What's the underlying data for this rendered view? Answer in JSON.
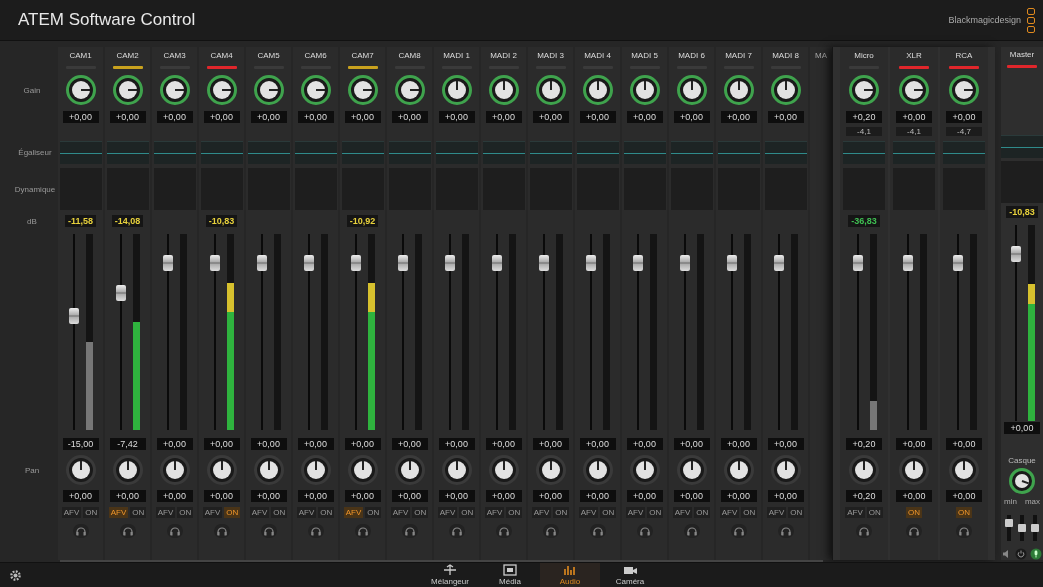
{
  "window": {
    "title": "ATEM Software Control",
    "brand": "Blackmagicdesign"
  },
  "row_labels": {
    "gain": "Gain",
    "eq": "Égaliseur",
    "dynamics": "Dynamique",
    "db": "dB",
    "pan": "Pan"
  },
  "channels": [
    {
      "name": "CAM1",
      "color": "#3a3a3a",
      "gain": {
        "value": "+0,00"
      },
      "peak": {
        "value": "-11,58",
        "kind": "warn"
      },
      "fader": {
        "level": 0.58,
        "value": "-15,00"
      },
      "meter": {
        "level": 0.45,
        "muted": true
      },
      "pan": {
        "value": "+0,00"
      },
      "afv": {
        "label": "AFV",
        "selected": false
      },
      "on": {
        "label": "ON",
        "selected": false
      }
    },
    {
      "name": "CAM2",
      "color": "#c9a21e",
      "gain": {
        "value": "+0,00"
      },
      "peak": {
        "value": "-14,08",
        "kind": "warn"
      },
      "fader": {
        "level": 0.7,
        "value": "-7,42"
      },
      "meter": {
        "level": 0.55,
        "muted": false
      },
      "pan": {
        "value": "+0,00"
      },
      "afv": {
        "label": "AFV",
        "selected": true
      },
      "on": {
        "label": "ON",
        "selected": false
      }
    },
    {
      "name": "CAM3",
      "color": "#3a3a3a",
      "gain": {
        "value": "+0,00"
      },
      "fader": {
        "level": 0.85,
        "value": "+0,00"
      },
      "pan": {
        "value": "+0,00"
      },
      "afv": {
        "label": "AFV",
        "selected": false
      },
      "on": {
        "label": "ON",
        "selected": false
      }
    },
    {
      "name": "CAM4",
      "color": "#e0262b",
      "gain": {
        "value": "+0,00"
      },
      "peak": {
        "value": "-10,83",
        "kind": "warn"
      },
      "fader": {
        "level": 0.85,
        "value": "+0,00"
      },
      "meter": {
        "level": 0.75,
        "muted": false
      },
      "pan": {
        "value": "+0,00"
      },
      "afv": {
        "label": "AFV",
        "selected": false
      },
      "on": {
        "label": "ON",
        "selected": true
      }
    },
    {
      "name": "CAM5",
      "color": "#3a3a3a",
      "gain": {
        "value": "+0,00"
      },
      "fader": {
        "level": 0.85,
        "value": "+0,00"
      },
      "pan": {
        "value": "+0,00"
      },
      "afv": {
        "label": "AFV",
        "selected": false
      },
      "on": {
        "label": "ON",
        "selected": false
      }
    },
    {
      "name": "CAM6",
      "color": "#3a3a3a",
      "gain": {
        "value": "+0,00"
      },
      "fader": {
        "level": 0.85,
        "value": "+0,00"
      },
      "pan": {
        "value": "+0,00"
      },
      "afv": {
        "label": "AFV",
        "selected": false
      },
      "on": {
        "label": "ON",
        "selected": false
      }
    },
    {
      "name": "CAM7",
      "color": "#c9a21e",
      "gain": {
        "value": "+0,00"
      },
      "peak": {
        "value": "-10,92",
        "kind": "warn"
      },
      "fader": {
        "level": 0.85,
        "value": "+0,00"
      },
      "meter": {
        "level": 0.75,
        "muted": false
      },
      "pan": {
        "value": "+0,00"
      },
      "afv": {
        "label": "AFV",
        "selected": true
      },
      "on": {
        "label": "ON",
        "selected": false
      }
    },
    {
      "name": "CAM8",
      "color": "#3a3a3a",
      "gain": {
        "value": "+0,00"
      },
      "fader": {
        "level": 0.85,
        "value": "+0,00"
      },
      "pan": {
        "value": "+0,00"
      },
      "afv": {
        "label": "AFV",
        "selected": false
      },
      "on": {
        "label": "ON",
        "selected": false
      }
    },
    {
      "name": "MADI 1",
      "color": "#3a3a3a",
      "gain": {
        "value": "+0,00"
      },
      "fader": {
        "level": 0.85,
        "value": "+0,00"
      },
      "pan": {
        "value": "+0,00"
      },
      "afv": {
        "label": "AFV",
        "selected": false
      },
      "on": {
        "label": "ON",
        "selected": false
      }
    },
    {
      "name": "MADI 2",
      "color": "#3a3a3a",
      "gain": {
        "value": "+0,00"
      },
      "fader": {
        "level": 0.85,
        "value": "+0,00"
      },
      "pan": {
        "value": "+0,00"
      },
      "afv": {
        "label": "AFV",
        "selected": false
      },
      "on": {
        "label": "ON",
        "selected": false
      }
    },
    {
      "name": "MADI 3",
      "color": "#3a3a3a",
      "gain": {
        "value": "+0,00"
      },
      "fader": {
        "level": 0.85,
        "value": "+0,00"
      },
      "pan": {
        "value": "+0,00"
      },
      "afv": {
        "label": "AFV",
        "selected": false
      },
      "on": {
        "label": "ON",
        "selected": false
      }
    },
    {
      "name": "MADI 4",
      "color": "#3a3a3a",
      "gain": {
        "value": "+0,00"
      },
      "fader": {
        "level": 0.85,
        "value": "+0,00"
      },
      "pan": {
        "value": "+0,00"
      },
      "afv": {
        "label": "AFV",
        "selected": false
      },
      "on": {
        "label": "ON",
        "selected": false
      }
    },
    {
      "name": "MADI 5",
      "color": "#3a3a3a",
      "gain": {
        "value": "+0,00"
      },
      "fader": {
        "level": 0.85,
        "value": "+0,00"
      },
      "pan": {
        "value": "+0,00"
      },
      "afv": {
        "label": "AFV",
        "selected": false
      },
      "on": {
        "label": "ON",
        "selected": false
      }
    },
    {
      "name": "MADI 6",
      "color": "#3a3a3a",
      "gain": {
        "value": "+0,00"
      },
      "fader": {
        "level": 0.85,
        "value": "+0,00"
      },
      "pan": {
        "value": "+0,00"
      },
      "afv": {
        "label": "AFV",
        "selected": false
      },
      "on": {
        "label": "ON",
        "selected": false
      }
    },
    {
      "name": "MADI 7",
      "color": "#3a3a3a",
      "gain": {
        "value": "+0,00"
      },
      "fader": {
        "level": 0.85,
        "value": "+0,00"
      },
      "pan": {
        "value": "+0,00"
      },
      "afv": {
        "label": "AFV",
        "selected": false
      },
      "on": {
        "label": "ON",
        "selected": false
      }
    },
    {
      "name": "MADI 8",
      "color": "#3a3a3a",
      "gain": {
        "value": "+0,00"
      },
      "fader": {
        "level": 0.85,
        "value": "+0,00"
      },
      "pan": {
        "value": "+0,00"
      },
      "afv": {
        "label": "AFV",
        "selected": false
      },
      "on": {
        "label": "ON",
        "selected": false
      }
    }
  ],
  "cut_channel": {
    "name": "MA"
  },
  "input_panel": [
    {
      "name": "Micro",
      "color": "#3a3a3a",
      "gain": {
        "value": "+0,20"
      },
      "trim": "-4,1",
      "peak": {
        "value": "-36,83",
        "kind": "ok"
      },
      "fader": {
        "level": 0.85,
        "value": "+0,20"
      },
      "meter": {
        "level": 0.15,
        "muted": true
      },
      "pan": {
        "value": "+0,20"
      },
      "afv": {
        "label": "AFV",
        "selected": false
      },
      "on": {
        "label": "ON",
        "selected": false
      }
    },
    {
      "name": "XLR",
      "color": "#e0262b",
      "gain": {
        "value": "+0,00"
      },
      "trim": "-4,1",
      "fader": {
        "level": 0.85,
        "value": "+0,00"
      },
      "pan": {
        "value": "+0,00"
      },
      "on": {
        "label": "ON",
        "selected": true
      }
    },
    {
      "name": "RCA",
      "color": "#e0262b",
      "gain": {
        "value": "+0,00"
      },
      "trim": "-4,7",
      "fader": {
        "level": 0.85,
        "value": "+0,00"
      },
      "pan": {
        "value": "+0,00"
      },
      "on": {
        "label": "ON",
        "selected": true
      }
    }
  ],
  "master": {
    "name": "Master",
    "color": "#e0262b",
    "peak": {
      "value": "-10,83",
      "kind": "warn"
    },
    "fader": {
      "level": 0.85,
      "value": "+0,00"
    },
    "meter": {
      "level": 0.7,
      "muted": false
    },
    "monitor": {
      "label": "Casque",
      "min": "min",
      "max": "max",
      "faders": [
        {
          "level": 0.7
        },
        {
          "level": 0.5
        },
        {
          "level": 0.5
        }
      ]
    }
  },
  "nav": [
    {
      "label": "Mélangeur",
      "selected": false
    },
    {
      "label": "Média",
      "selected": false
    },
    {
      "label": "Audio",
      "selected": true
    },
    {
      "label": "Caméra",
      "selected": false
    }
  ]
}
